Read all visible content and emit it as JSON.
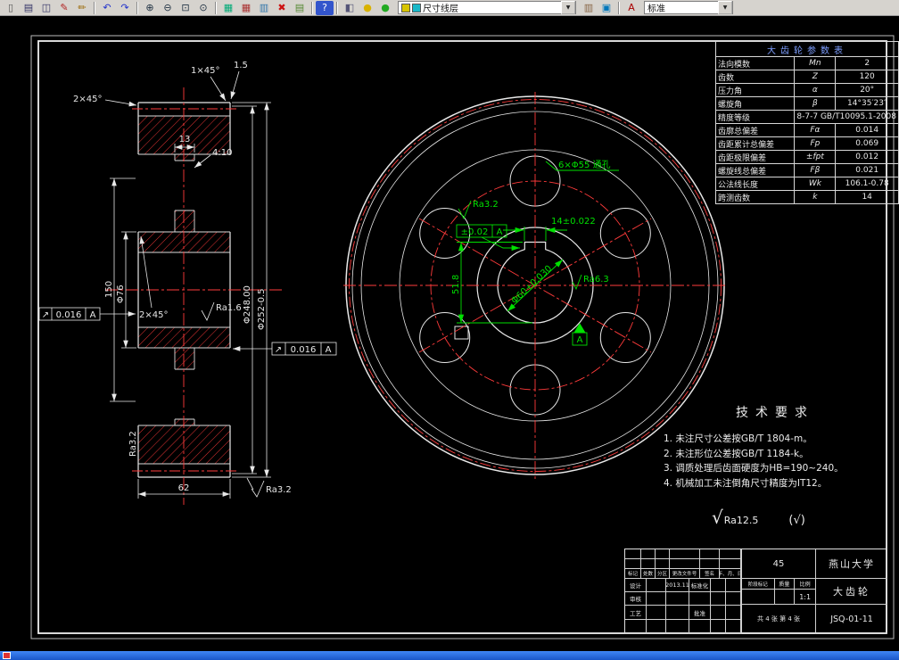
{
  "toolbar": {
    "layer_combo": "尺寸线层",
    "style_combo": "标准",
    "icons_left": [
      {
        "name": "new-icon",
        "g": "▯",
        "c": "#555"
      },
      {
        "name": "print-icon",
        "g": "▤",
        "c": "#336"
      },
      {
        "name": "print-preview-icon",
        "g": "◫",
        "c": "#336"
      },
      {
        "name": "edit-icon",
        "g": "✎",
        "c": "#b22222"
      },
      {
        "name": "edit-attr-icon",
        "g": "✏",
        "c": "#996600"
      },
      {
        "sep": true
      },
      {
        "name": "undo-icon",
        "g": "↶",
        "c": "#2233cc"
      },
      {
        "name": "redo-icon",
        "g": "↷",
        "c": "#2233cc"
      },
      {
        "sep": true
      },
      {
        "name": "zoom-in-icon",
        "g": "⊕",
        "c": "#223344"
      },
      {
        "name": "zoom-out-icon",
        "g": "⊖",
        "c": "#223344"
      },
      {
        "name": "zoom-window-icon",
        "g": "⊡",
        "c": "#223344"
      },
      {
        "name": "zoom-extents-icon",
        "g": "⊙",
        "c": "#223344"
      },
      {
        "sep": true
      },
      {
        "name": "layer-manager-icon",
        "g": "▦",
        "c": "#00aa77"
      },
      {
        "name": "table-icon",
        "g": "▦",
        "c": "#aa3333"
      },
      {
        "name": "block-icon",
        "g": "▥",
        "c": "#3377aa"
      },
      {
        "name": "erase-icon",
        "g": "✖",
        "c": "#cc1111"
      },
      {
        "name": "grid-icon",
        "g": "▤",
        "c": "#558833"
      },
      {
        "sep": true
      },
      {
        "name": "help-icon",
        "g": "?",
        "c": "#ffffff",
        "bg": "#3355cc"
      },
      {
        "sep": true
      },
      {
        "name": "view-icon",
        "g": "◧",
        "c": "#555577"
      },
      {
        "name": "render-ball-yellow-icon",
        "g": "●",
        "c": "#d9b200"
      },
      {
        "name": "render-ball-green-icon",
        "g": "●",
        "c": "#22aa22"
      }
    ],
    "icons_mid": [
      {
        "name": "layer-list-icon",
        "g": "▥",
        "c": "#886644"
      },
      {
        "name": "layer-color-icon",
        "g": "▣",
        "c": "#0077bb"
      },
      {
        "sep": true
      },
      {
        "name": "text-style-icon",
        "g": "A",
        "c": "#aa0000"
      }
    ]
  },
  "param_table": {
    "title": "大齿轮参数表",
    "rows": [
      {
        "label": "法向模数",
        "sym": "Mn",
        "val": "2"
      },
      {
        "label": "齿数",
        "sym": "Z",
        "val": "120"
      },
      {
        "label": "压力角",
        "sym": "α",
        "val": "20°"
      },
      {
        "label": "螺旋角",
        "sym": "β",
        "val": "14°35′23″"
      },
      {
        "label": "精度等级",
        "span": true,
        "val": "8-7-7 GB/T10095.1-2008"
      },
      {
        "label": "齿廓总偏差",
        "sym": "Fα",
        "val": "0.014"
      },
      {
        "label": "齿距累计总偏差",
        "sym": "Fp",
        "val": "0.069"
      },
      {
        "label": "齿距极限偏差",
        "sym": "±fpt",
        "val": "0.012"
      },
      {
        "label": "螺旋线总偏差",
        "sym": "Fβ",
        "val": "0.021"
      },
      {
        "label": "公法线长度",
        "sym": "Wk",
        "val": "106.1-0.78"
      },
      {
        "label": "跨测齿数",
        "sym": "k",
        "val": "14"
      }
    ]
  },
  "tech_req": {
    "title": "技术要求",
    "items": [
      "1. 未注尺寸公差按GB/T 1804-m。",
      "2. 未注形位公差按GB/T 1184-k。",
      "3. 调质处理后齿面硬度为HB=190~240。",
      "4. 机械加工未注倒角尺寸精度为IT12。"
    ],
    "finish_symbol": "√",
    "finish_all": "Ra12.5",
    "finish_rest": "(√)"
  },
  "dims": {
    "width": "62",
    "hub_len": "150",
    "hub_dia": "Φ76",
    "pitch_dia": "Φ248.00",
    "outer_dia": "Φ252-0.5",
    "web": "13",
    "taper": "4:10",
    "chamfer1": "1×45°",
    "radius": "1.5",
    "chamfer2": "2×45°",
    "chamfer3": "2×45°",
    "ra16": "Ra1.6",
    "ra32_left": "Ra3.2",
    "ra32_bottom": "Ra3.2",
    "runout_sym": "↗",
    "runout_val": "0.016",
    "runout_datum": "A",
    "runout_sym2": "↗",
    "runout_val2": "0.016",
    "runout_datum2": "A",
    "holes": "6×Φ55 通孔",
    "ra32_key": "Ra3.2",
    "sym_val": "±0.02",
    "sym_datum": "A",
    "key_width": "14±0.022",
    "key_depth": "51.8",
    "bore_dia": "Φ60+0.030",
    "ra63": "Ra6.3",
    "datum_a": "A"
  },
  "title_block": {
    "university": "燕山大学",
    "part_name": "大齿轮",
    "drawing_no": "JSQ-01-11",
    "material": "45",
    "stage_label": "阶段标记",
    "mass_label": "质量",
    "scale_label": "比例",
    "scale": "1:1",
    "sheets": "共 4 张 第 4 张",
    "rev_headers": [
      "标记",
      "处数",
      "分区",
      "更改文件号",
      "签名",
      "年、月、日"
    ],
    "staff_rows": [
      [
        "设计",
        "",
        "2013.11",
        "标准化",
        "",
        ""
      ],
      [
        "审核",
        "",
        "",
        "",
        "",
        ""
      ],
      [
        "工艺",
        "",
        "",
        "批准",
        "",
        ""
      ],
      [
        "",
        "",
        "",
        "",
        "",
        ""
      ]
    ]
  }
}
